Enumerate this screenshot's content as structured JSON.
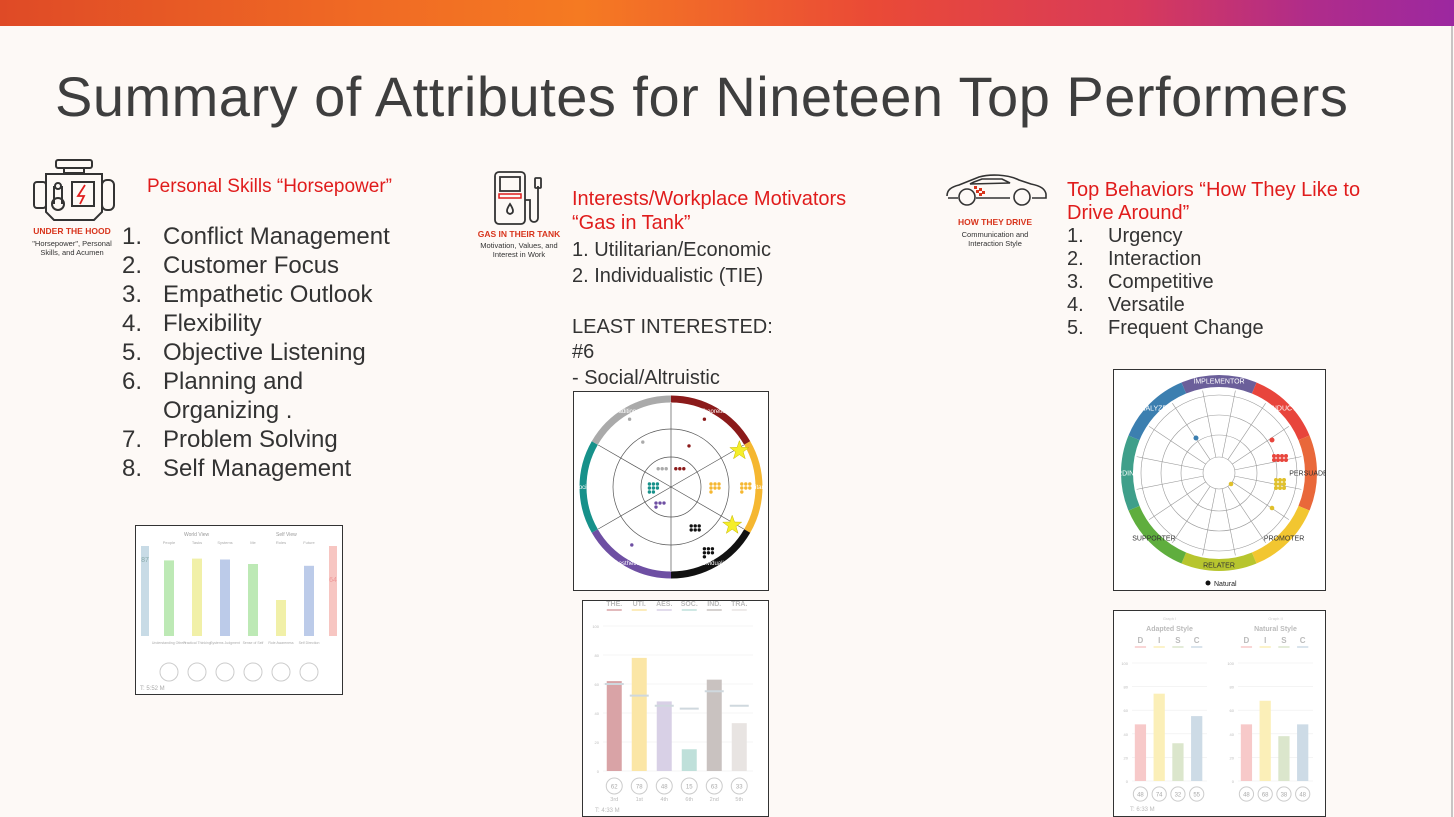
{
  "slide": {
    "title": "Summary of Attributes for Nineteen Top Performers",
    "colors": {
      "accent_red": "#e01c1c",
      "title": "#3e3e3e"
    }
  },
  "col1": {
    "icon": "engine-icon",
    "icon_label": "UNDER THE HOOD",
    "icon_sub": [
      "\"Horsepower\", Personal",
      "Skills, and Acumen"
    ],
    "heading": "Personal Skills “Horsepower”",
    "items": [
      {
        "n": "1.",
        "t": "Conflict Management"
      },
      {
        "n": "2.",
        "t": "Customer Focus"
      },
      {
        "n": "3.",
        "t": "Empathetic Outlook"
      },
      {
        "n": "4.",
        "t": "Flexibility"
      },
      {
        "n": "5.",
        "t": "Objective Listening"
      },
      {
        "n": "6.",
        "t": "Planning and"
      },
      {
        "n": "",
        "t": "Organizing ."
      },
      {
        "n": "7.",
        "t": "Problem Solving"
      },
      {
        "n": "8.",
        "t": "Self Management"
      }
    ]
  },
  "col2": {
    "icon": "gas-pump-icon",
    "icon_label": "GAS IN THEIR TANK",
    "icon_sub": [
      "Motivation, Values, and",
      "Interest in Work"
    ],
    "heading": [
      "Interests/Workplace Motivators",
      "“Gas in Tank”"
    ],
    "lines": [
      "1. Utilitarian/Economic",
      "2. Individualistic  (TIE)",
      "",
      "LEAST INTERESTED:",
      "#6",
      "- Social/Altruistic"
    ]
  },
  "col3": {
    "icon": "sports-car-icon",
    "icon_label": "HOW THEY DRIVE",
    "icon_sub": [
      "Communication and",
      "Interaction Style"
    ],
    "heading": [
      "Top Behaviors  “How They Like to",
      "Drive Around”"
    ],
    "items": [
      {
        "n": "1.",
        "t": "Urgency"
      },
      {
        "n": "2.",
        "t": "Interaction"
      },
      {
        "n": "3.",
        "t": "Competitive"
      },
      {
        "n": "4.",
        "t": "Versatile"
      },
      {
        "n": "5.",
        "t": "Frequent Change"
      }
    ]
  },
  "acumen_chart": {
    "groups": [
      "World View",
      "Self View"
    ],
    "dims": [
      "People",
      "Tasks",
      "Systems",
      "Me",
      "Roles",
      "Future"
    ],
    "labels": [
      "Understanding Others",
      "Practical Thinking",
      "Systems Judgment",
      "Sense of Self",
      "Role Awareness",
      "Self Direction"
    ],
    "values": [
      84,
      86,
      85,
      80,
      40,
      78
    ],
    "left_score": "87",
    "right_score": "64",
    "time": "T: 5:52 M"
  },
  "values_wheel": {
    "segments": [
      "Theoretical",
      "Utilitarian",
      "Individualistic",
      "Aesthetic",
      "Social",
      "Traditional"
    ],
    "colors": [
      "#8b1a1a",
      "#f5b731",
      "#111111",
      "#6e4fa3",
      "#17918a",
      "#aaaaaa"
    ]
  },
  "chart_data": [
    {
      "type": "bar",
      "categories": [
        "THE.",
        "UTI.",
        "AES.",
        "SOC.",
        "IND.",
        "TRA."
      ],
      "values": [
        62,
        78,
        48,
        15,
        63,
        33
      ],
      "means": [
        60,
        52,
        45,
        43,
        55,
        45
      ],
      "ranks": [
        "3rd",
        "1st",
        "4th",
        "6th",
        "2nd",
        "5th"
      ],
      "ylim": [
        0,
        100
      ],
      "yticks": [
        "0",
        "20",
        "40",
        "60",
        "80",
        "100"
      ],
      "grid": true,
      "colors": [
        "#d9a3a6",
        "#fbe6a6",
        "#d8d0e6",
        "#bfe0da",
        "#c9c2c0",
        "#e8e4e2"
      ],
      "time": "T: 4:33 M"
    },
    {
      "type": "bar",
      "title": "Adapted Style",
      "subtitle": "Graph I",
      "categories": [
        "D",
        "I",
        "S",
        "C"
      ],
      "values": [
        48,
        74,
        32,
        55
      ],
      "ylim": [
        0,
        100
      ],
      "yticks": [
        "0",
        "20",
        "40",
        "60",
        "80",
        "100"
      ],
      "colors": [
        "#f7c9c9",
        "#fbefb8",
        "#dbe6cc",
        "#cddbe6"
      ],
      "time": "T: 6:33 M"
    },
    {
      "type": "bar",
      "title": "Natural Style",
      "subtitle": "Graph II",
      "categories": [
        "D",
        "I",
        "S",
        "C"
      ],
      "values": [
        48,
        68,
        38,
        48
      ],
      "ylim": [
        0,
        100
      ],
      "yticks": [
        "0",
        "20",
        "40",
        "60",
        "80",
        "100"
      ],
      "colors": [
        "#f7c9c9",
        "#fbefb8",
        "#dbe6cc",
        "#cddbe6"
      ]
    }
  ],
  "behavior_wheel": {
    "segments": [
      "IMPLEMENTOR",
      "CONDUCTOR",
      "PERSUADER",
      "PROMOTER",
      "RELATER",
      "SUPPORTER",
      "COORDINATOR",
      "ANALYZER"
    ],
    "legend": "Natural"
  }
}
